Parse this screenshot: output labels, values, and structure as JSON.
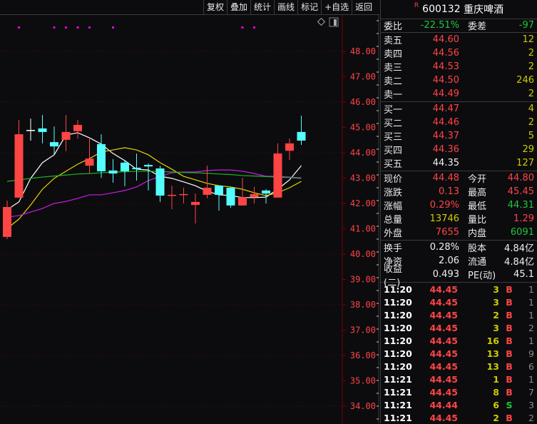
{
  "toolbar": {
    "buttons": [
      "复权",
      "叠加",
      "统计",
      "画线",
      "标记",
      "+自选",
      "返回"
    ]
  },
  "chart_icons": [
    "diamond-icon",
    "panel-toggle-icon"
  ],
  "colors": {
    "up": "#ff4444",
    "down": "#54ffff",
    "ma5": "#ffffff",
    "ma10": "#e6d200",
    "ma20": "#c81ee6",
    "ma60": "#1eb41e",
    "axis": "#7a0000",
    "axis_label": "#ff4444",
    "marker": "#e600e6"
  },
  "chart_data": {
    "type": "candlestick",
    "y_ticks": [
      "48.00",
      "47.00",
      "46.00",
      "45.00",
      "44.00",
      "43.00",
      "42.00",
      "41.00",
      "40.00",
      "39.00",
      "38.00",
      "37.00",
      "36.00",
      "35.00",
      "34.00"
    ],
    "ylim": [
      33.4,
      49.4
    ],
    "grid_at": [
      48,
      46,
      44,
      42,
      40,
      38,
      36,
      34
    ],
    "candles": [
      {
        "o": 40.68,
        "h": 42.11,
        "l": 40.59,
        "c": 41.86
      },
      {
        "o": 42.23,
        "h": 45.3,
        "l": 42.23,
        "c": 44.73
      },
      {
        "o": 44.9,
        "h": 45.35,
        "l": 44.48,
        "c": 44.9
      },
      {
        "o": 44.96,
        "h": 45.49,
        "l": 44.37,
        "c": 44.82
      },
      {
        "o": 44.42,
        "h": 45.04,
        "l": 43.94,
        "c": 44.25
      },
      {
        "o": 44.51,
        "h": 45.49,
        "l": 44.06,
        "c": 44.82
      },
      {
        "o": 44.85,
        "h": 45.3,
        "l": 44.56,
        "c": 45.1
      },
      {
        "o": 43.49,
        "h": 44.59,
        "l": 43.18,
        "c": 43.77
      },
      {
        "o": 44.34,
        "h": 44.73,
        "l": 43.01,
        "c": 43.27
      },
      {
        "o": 43.3,
        "h": 43.75,
        "l": 42.82,
        "c": 43.18
      },
      {
        "o": 43.61,
        "h": 43.72,
        "l": 42.68,
        "c": 43.27
      },
      {
        "o": 43.41,
        "h": 43.97,
        "l": 42.9,
        "c": 43.35
      },
      {
        "o": 43.52,
        "h": 43.58,
        "l": 42.51,
        "c": 43.46
      },
      {
        "o": 43.38,
        "h": 43.49,
        "l": 42.06,
        "c": 42.31
      },
      {
        "o": 42.34,
        "h": 42.7,
        "l": 41.77,
        "c": 42.34
      },
      {
        "o": 42.37,
        "h": 42.62,
        "l": 42.0,
        "c": 42.37
      },
      {
        "o": 41.94,
        "h": 42.39,
        "l": 41.21,
        "c": 42.06
      },
      {
        "o": 42.34,
        "h": 43.49,
        "l": 42.2,
        "c": 42.62
      },
      {
        "o": 42.7,
        "h": 42.7,
        "l": 41.72,
        "c": 42.34
      },
      {
        "o": 42.62,
        "h": 42.65,
        "l": 41.83,
        "c": 41.92
      },
      {
        "o": 41.92,
        "h": 43.01,
        "l": 41.92,
        "c": 42.25
      },
      {
        "o": 42.25,
        "h": 42.65,
        "l": 42.0,
        "c": 42.37
      },
      {
        "o": 42.51,
        "h": 42.56,
        "l": 42.0,
        "c": 42.39
      },
      {
        "o": 42.23,
        "h": 44.37,
        "l": 42.23,
        "c": 43.97
      },
      {
        "o": 44.08,
        "h": 44.56,
        "l": 43.72,
        "c": 44.37
      },
      {
        "o": 44.82,
        "h": 45.46,
        "l": 44.31,
        "c": 44.48
      }
    ],
    "ma": [
      {
        "name": "ma5",
        "values": [
          41.75,
          42.06,
          42.99,
          43.61,
          43.92,
          44.7,
          44.79,
          44.59,
          44.34,
          43.97,
          43.69,
          43.35,
          43.32,
          43.07,
          42.99,
          42.85,
          42.7,
          42.48,
          42.34,
          42.31,
          42.23,
          42.23,
          42.25,
          42.56,
          42.93,
          43.49
        ]
      },
      {
        "name": "ma10",
        "values": [
          41.01,
          41.38,
          41.94,
          42.56,
          42.99,
          43.27,
          43.55,
          43.77,
          44.03,
          44.11,
          44.2,
          44.11,
          43.92,
          43.61,
          43.35,
          43.07,
          42.93,
          42.79,
          42.7,
          42.65,
          42.56,
          42.42,
          42.31,
          42.42,
          42.62,
          42.87
        ]
      },
      {
        "name": "ma20",
        "values": [
          41.46,
          41.52,
          41.66,
          41.8,
          42.0,
          42.08,
          42.2,
          42.34,
          42.34,
          42.42,
          42.51,
          42.65,
          42.9,
          43.07,
          43.21,
          43.24,
          43.24,
          43.3,
          43.32,
          43.32,
          43.27,
          43.18,
          43.07,
          43.07,
          43.04,
          43.01
        ]
      },
      {
        "name": "ma60",
        "values": [
          42.87,
          42.93,
          42.99,
          43.04,
          43.08,
          43.12,
          43.16,
          43.18,
          43.21,
          43.24,
          43.25,
          43.27,
          43.27,
          43.26,
          43.24,
          43.22,
          43.21,
          43.19,
          43.16,
          43.14,
          43.1,
          43.08,
          43.06,
          43.04,
          43.02,
          42.99
        ]
      }
    ],
    "markers_at_candle": [
      1,
      4,
      5,
      6,
      7,
      9,
      20,
      21
    ]
  },
  "quote": {
    "flag": "R",
    "code": "600132",
    "name": "重庆啤酒",
    "weibi": {
      "label": "委比",
      "value": "-22.51%",
      "label2": "委差",
      "value2": "-97"
    },
    "sell": [
      {
        "label": "卖五",
        "price": "44.60",
        "vol": "12"
      },
      {
        "label": "卖四",
        "price": "44.56",
        "vol": "2"
      },
      {
        "label": "卖三",
        "price": "44.53",
        "vol": "2"
      },
      {
        "label": "卖二",
        "price": "44.50",
        "vol": "246"
      },
      {
        "label": "卖一",
        "price": "44.49",
        "vol": "2"
      }
    ],
    "buy": [
      {
        "label": "买一",
        "price": "44.47",
        "vol": "4"
      },
      {
        "label": "买二",
        "price": "44.46",
        "vol": "2"
      },
      {
        "label": "买三",
        "price": "44.37",
        "vol": "5"
      },
      {
        "label": "买四",
        "price": "44.36",
        "vol": "29"
      },
      {
        "label": "买五",
        "price": "44.35",
        "vol": "127"
      }
    ],
    "stats": [
      {
        "l": "现价",
        "v": "44.48",
        "vc": "red",
        "l2": "今开",
        "v2": "44.80",
        "v2c": "red"
      },
      {
        "l": "涨跌",
        "v": "0.13",
        "vc": "red",
        "l2": "最高",
        "v2": "45.45",
        "v2c": "red"
      },
      {
        "l": "涨幅",
        "v": "0.29%",
        "vc": "red",
        "l2": "最低",
        "v2": "44.31",
        "v2c": "grn"
      },
      {
        "l": "总量",
        "v": "13746",
        "vc": "yel",
        "l2": "量比",
        "v2": "1.29",
        "v2c": "red"
      },
      {
        "l": "外盘",
        "v": "7655",
        "vc": "red",
        "l2": "内盘",
        "v2": "6091",
        "v2c": "grn"
      }
    ],
    "fundamentals": [
      {
        "l": "换手",
        "v": "0.28%",
        "l2": "股本",
        "v2": "4.84亿"
      },
      {
        "l": "净资",
        "v": "2.06",
        "l2": "流通",
        "v2": "4.84亿"
      },
      {
        "l": "收益(二)",
        "v": "0.493",
        "l2": "PE(动)",
        "v2": "45.1"
      }
    ],
    "trades": [
      {
        "t": "11:20",
        "p": "44.45",
        "q": "3",
        "bs": "B",
        "n": "1"
      },
      {
        "t": "11:20",
        "p": "44.45",
        "q": "3",
        "bs": "B",
        "n": "1"
      },
      {
        "t": "11:20",
        "p": "44.45",
        "q": "2",
        "bs": "B",
        "n": "1"
      },
      {
        "t": "11:20",
        "p": "44.45",
        "q": "3",
        "bs": "B",
        "n": "2"
      },
      {
        "t": "11:20",
        "p": "44.45",
        "q": "16",
        "bs": "B",
        "n": "1"
      },
      {
        "t": "11:20",
        "p": "44.45",
        "q": "13",
        "bs": "B",
        "n": "9"
      },
      {
        "t": "11:20",
        "p": "44.45",
        "q": "13",
        "bs": "B",
        "n": "6"
      },
      {
        "t": "11:21",
        "p": "44.45",
        "q": "1",
        "bs": "B",
        "n": "1"
      },
      {
        "t": "11:21",
        "p": "44.45",
        "q": "8",
        "bs": "B",
        "n": "7"
      },
      {
        "t": "11:21",
        "p": "44.44",
        "q": "6",
        "bs": "S",
        "n": "3"
      },
      {
        "t": "11:21",
        "p": "44.45",
        "q": "2",
        "bs": "B",
        "n": "2"
      }
    ]
  }
}
